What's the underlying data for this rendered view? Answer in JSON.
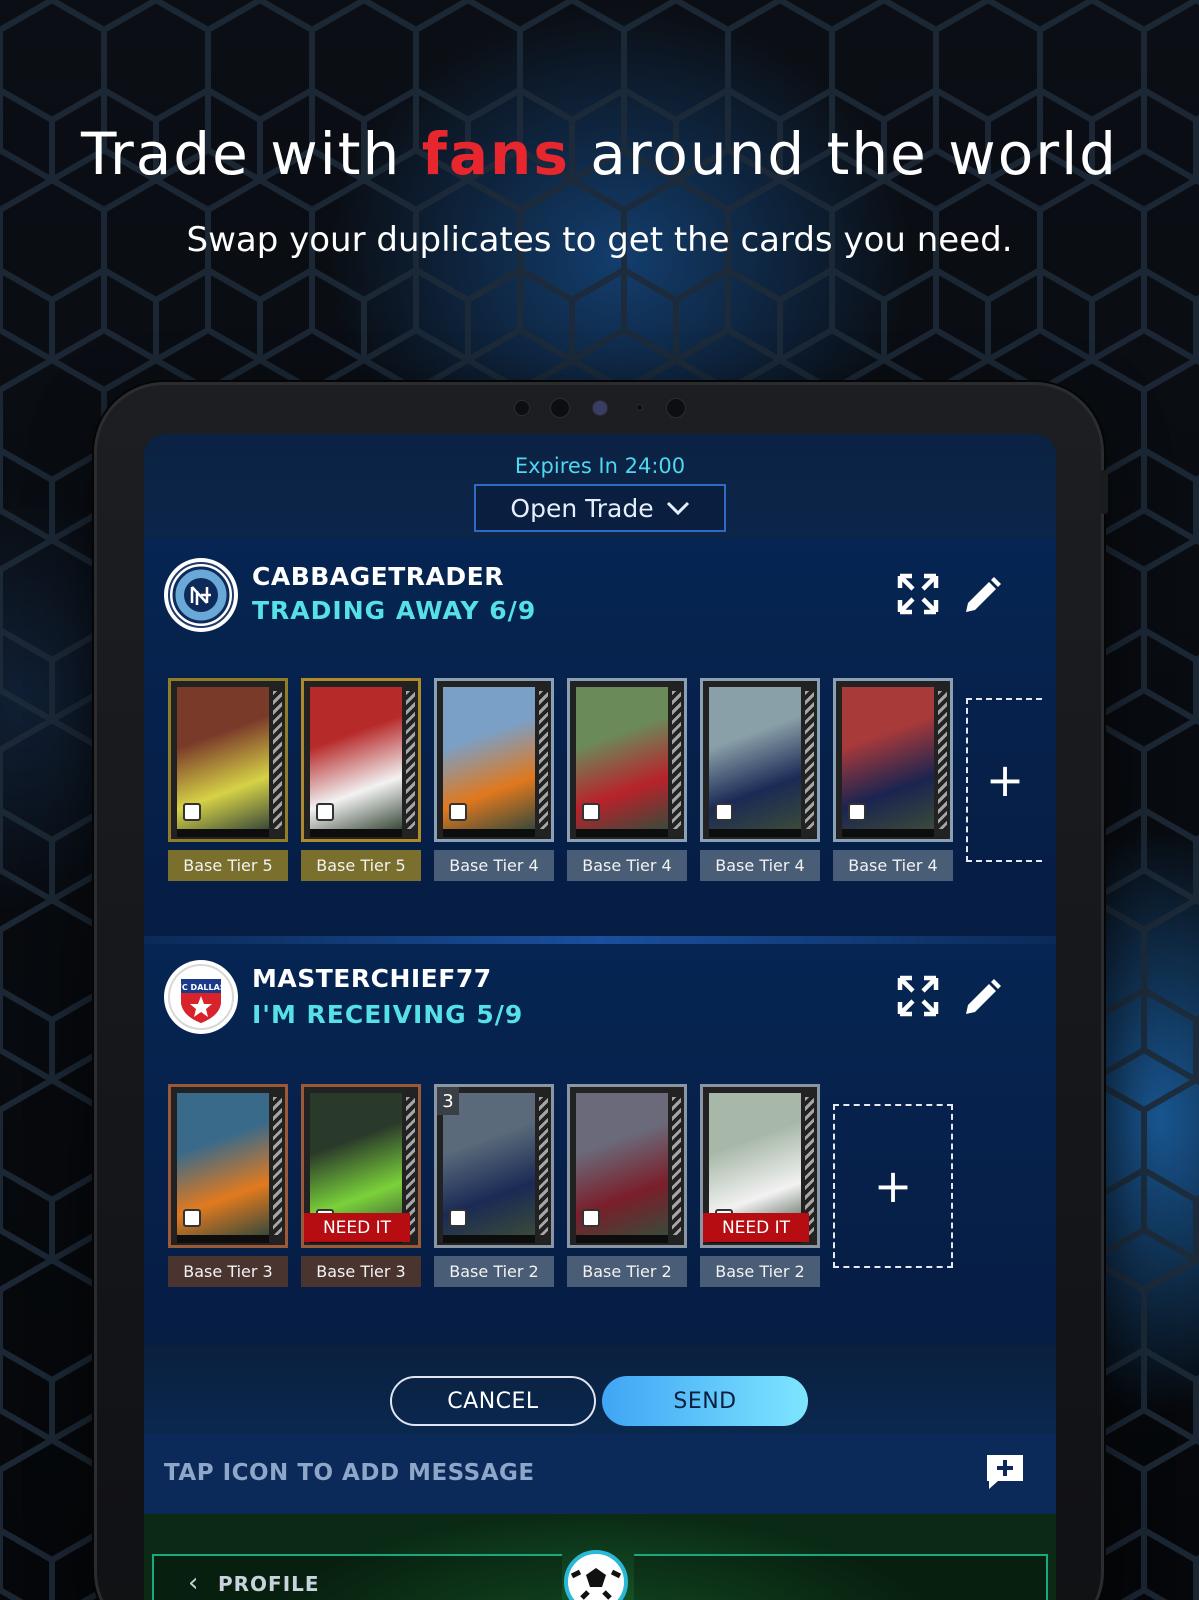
{
  "promo": {
    "headline_pre": "Trade with ",
    "headline_accent": "fans",
    "headline_post": " around the world",
    "subheadline": "Swap your duplicates to get the cards you need."
  },
  "trade": {
    "expires": "Expires In 24:00",
    "type_select": "Open Trade"
  },
  "sender": {
    "username": "CABBAGETRADER",
    "status": "TRADING AWAY 6/9",
    "cards": [
      {
        "tier": "Base Tier 5",
        "tier_color": "#7a6f2c",
        "border": "#8f7d2a",
        "photo": [
          "#7a3a2a",
          "#d6d246"
        ]
      },
      {
        "tier": "Base Tier 5",
        "tier_color": "#7a6f2c",
        "border": "#b08a2a",
        "photo": [
          "#b72a2a",
          "#f2f2f2"
        ]
      },
      {
        "tier": "Base Tier 4",
        "tier_color": "#4a5d76",
        "border": "#8aa0b4",
        "photo": [
          "#7aa0c8",
          "#e0781e"
        ]
      },
      {
        "tier": "Base Tier 4",
        "tier_color": "#4a5d76",
        "border": "#8aa0b4",
        "photo": [
          "#6b8a5a",
          "#b8222a"
        ]
      },
      {
        "tier": "Base Tier 4",
        "tier_color": "#4a5d76",
        "border": "#8aa0b4",
        "photo": [
          "#8aa0a8",
          "#1a2a55"
        ]
      },
      {
        "tier": "Base Tier 4",
        "tier_color": "#4a5d76",
        "border": "#8aa0b4",
        "photo": [
          "#a83a3a",
          "#1a2450"
        ]
      }
    ],
    "add_label": "+"
  },
  "receiver": {
    "username": "MASTERCHIEF77",
    "status": "I'M RECEIVING 5/9",
    "cards": [
      {
        "tier": "Base Tier 3",
        "tier_color": "#4a3430",
        "border": "#9a5a3a",
        "photo": [
          "#3a6a8a",
          "#e27a1e"
        ],
        "need": ""
      },
      {
        "tier": "Base Tier 3",
        "tier_color": "#4a3430",
        "border": "#9a5a3a",
        "photo": [
          "#2a3a2a",
          "#7ad23a"
        ],
        "need": "NEED IT"
      },
      {
        "tier": "Base Tier 2",
        "tier_color": "#4a5d76",
        "border": "#8a96a4",
        "photo": [
          "#5a6a7a",
          "#1a2a55"
        ],
        "need": "",
        "count": "3"
      },
      {
        "tier": "Base Tier 2",
        "tier_color": "#4a5d76",
        "border": "#8a96a4",
        "photo": [
          "#6a6a7a",
          "#7a1e2a"
        ],
        "need": ""
      },
      {
        "tier": "Base Tier 2",
        "tier_color": "#4a5d76",
        "border": "#8a96a4",
        "photo": [
          "#a8b8a8",
          "#f2f2f2"
        ],
        "need": "NEED IT"
      }
    ],
    "add_label": "+"
  },
  "actions": {
    "cancel": "CANCEL",
    "send": "SEND"
  },
  "message": {
    "label": "TAP ICON TO ADD MESSAGE"
  },
  "nav": {
    "profile": "PROFILE",
    "back_chevron": "‹"
  },
  "colors": {
    "accent_red": "#e8262e",
    "cyan": "#56e0e8",
    "need_red": "#b60d12",
    "send_blue": "#3fa5f5"
  },
  "icons": {
    "expand": "expand-icon",
    "edit": "pencil-icon",
    "add_message": "message-plus-icon",
    "dropdown": "chevron-down-icon"
  }
}
